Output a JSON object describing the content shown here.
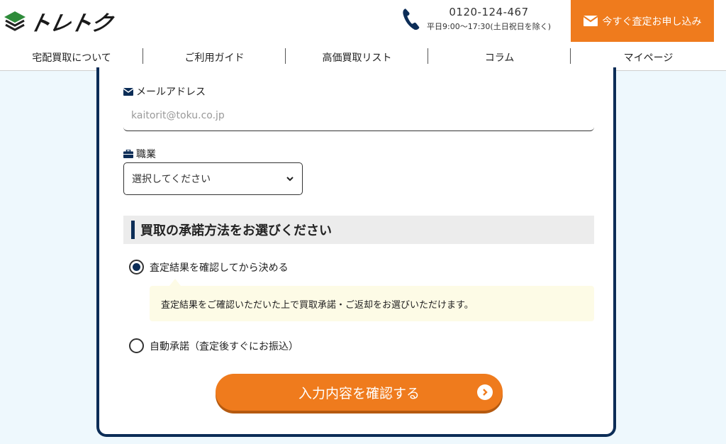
{
  "header": {
    "logo_text": "トレトク",
    "phone_number": "0120-124-467",
    "phone_hours": "平日9:00～17:30(土日祝日を除く)",
    "apply_label": "今すぐ査定お申し込み"
  },
  "nav": {
    "items": [
      {
        "label": "宅配買取について"
      },
      {
        "label": "ご利用ガイド"
      },
      {
        "label": "高価買取リスト"
      },
      {
        "label": "コラム"
      },
      {
        "label": "マイページ"
      }
    ]
  },
  "form": {
    "email_label": "メールアドレス",
    "email_placeholder": "kaitorit@toku.co.jp",
    "occupation_label": "職業",
    "occupation_selected": "選択してください",
    "section_title": "買取の承諾方法をお選びください",
    "option_confirm": "査定結果を確認してから決める",
    "option_confirm_note": "査定結果をご確認いただいた上で買取承諾・ご返却をお選びいただけます。",
    "option_auto": "自動承諾（査定後すぐにお振込）",
    "confirm_button": "入力内容を確認する"
  },
  "colors": {
    "accent": "#ef7b1d",
    "navy": "#0c2d57",
    "background": "#eef8fd",
    "logo_green": "#2e8b3a"
  }
}
